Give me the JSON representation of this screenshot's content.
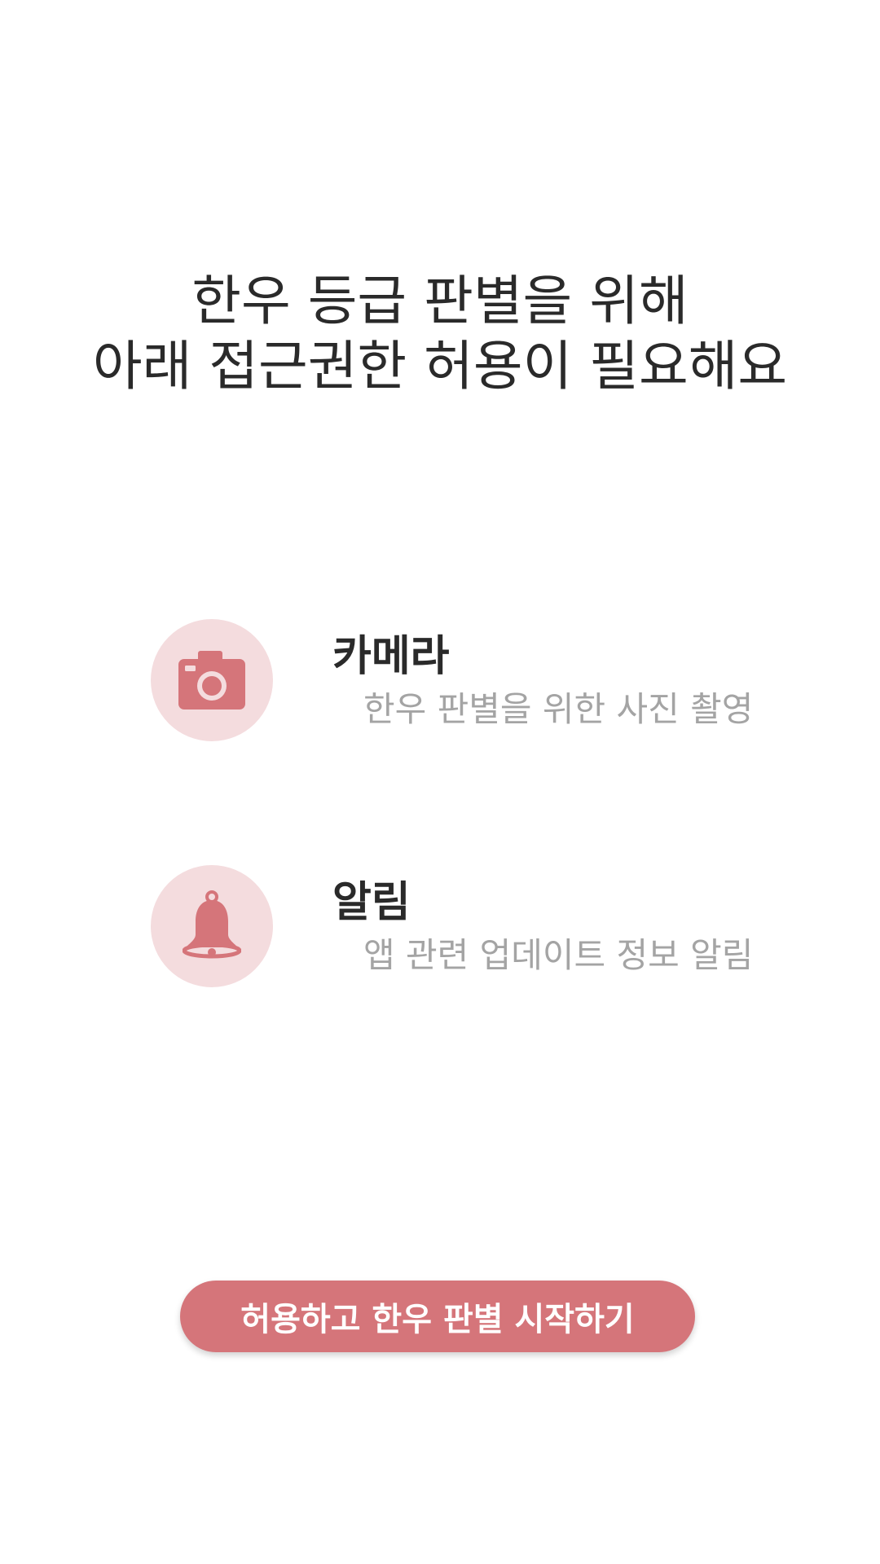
{
  "header": {
    "title_line1": "한우 등급 판별을 위해",
    "title_line2": "아래 접근권한 허용이 필요해요"
  },
  "permissions": [
    {
      "icon": "camera-icon",
      "title": "카메라",
      "description": "한우 판별을 위한 사진 촬영"
    },
    {
      "icon": "bell-icon",
      "title": "알림",
      "description": "앱 관련 업데이트 정보 알림"
    }
  ],
  "cta": {
    "label": "허용하고 한우 판별 시작하기"
  },
  "colors": {
    "accent": "#d5757a",
    "icon_bg": "#f4dcde",
    "title_text": "#2a2a2a",
    "description_text": "#a4a4a4"
  }
}
